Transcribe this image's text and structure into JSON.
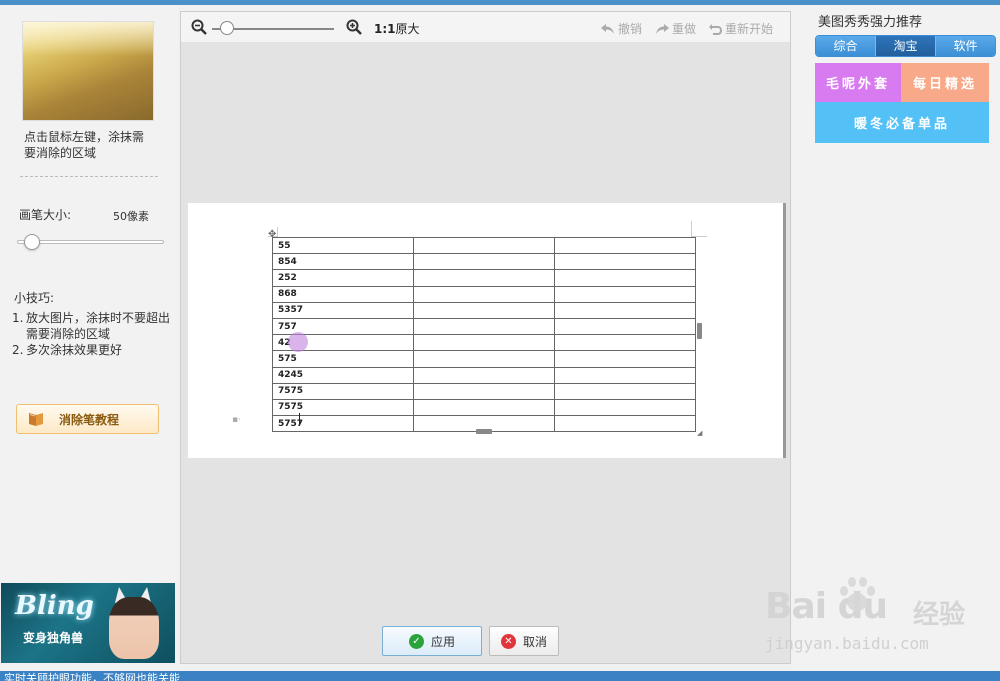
{
  "left_panel": {
    "hint": "点击鼠标左键，涂抹需要消除的区域",
    "brush_size_label": "画笔大小:",
    "brush_size_value": "50像素",
    "tips_title": "小技巧:",
    "tips": [
      {
        "num": "1.",
        "text": "放大图片，涂抹时不要超出需要消除的区域"
      },
      {
        "num": "2.",
        "text": "多次涂抹效果更好"
      }
    ],
    "tutorial_button": "消除笔教程",
    "ad": {
      "title": "Bling",
      "subtitle": "变身独角兽"
    }
  },
  "toolbar": {
    "actual_size_ratio": "1:1",
    "actual_size_label": "原大",
    "undo": "撤销",
    "redo": "重做",
    "restart": "重新开始"
  },
  "table": {
    "rows": [
      [
        "55",
        "",
        ""
      ],
      [
        "854",
        "",
        ""
      ],
      [
        "252",
        "",
        ""
      ],
      [
        "868",
        "",
        ""
      ],
      [
        "5357",
        "",
        ""
      ],
      [
        "757",
        "",
        ""
      ],
      [
        "42",
        "",
        ""
      ],
      [
        "575",
        "",
        ""
      ],
      [
        "4245",
        "",
        ""
      ],
      [
        "7575",
        "",
        ""
      ],
      [
        "7575",
        "",
        ""
      ],
      [
        "5757",
        "",
        ""
      ]
    ]
  },
  "buttons": {
    "apply": "应用",
    "cancel": "取消"
  },
  "right_panel": {
    "title": "美图秀秀强力推荐",
    "tabs": [
      {
        "label": "综合",
        "active": false
      },
      {
        "label": "淘宝",
        "active": true
      },
      {
        "label": "软件",
        "active": false
      }
    ],
    "promos": [
      "毛呢外套",
      "每日精选",
      "暖冬必备单品"
    ]
  },
  "watermark": {
    "brand": "Bai du",
    "product": "经验",
    "url": "jingyan.baidu.com"
  },
  "status_bar": "实时关顾护眼功能，不够网也能关能"
}
